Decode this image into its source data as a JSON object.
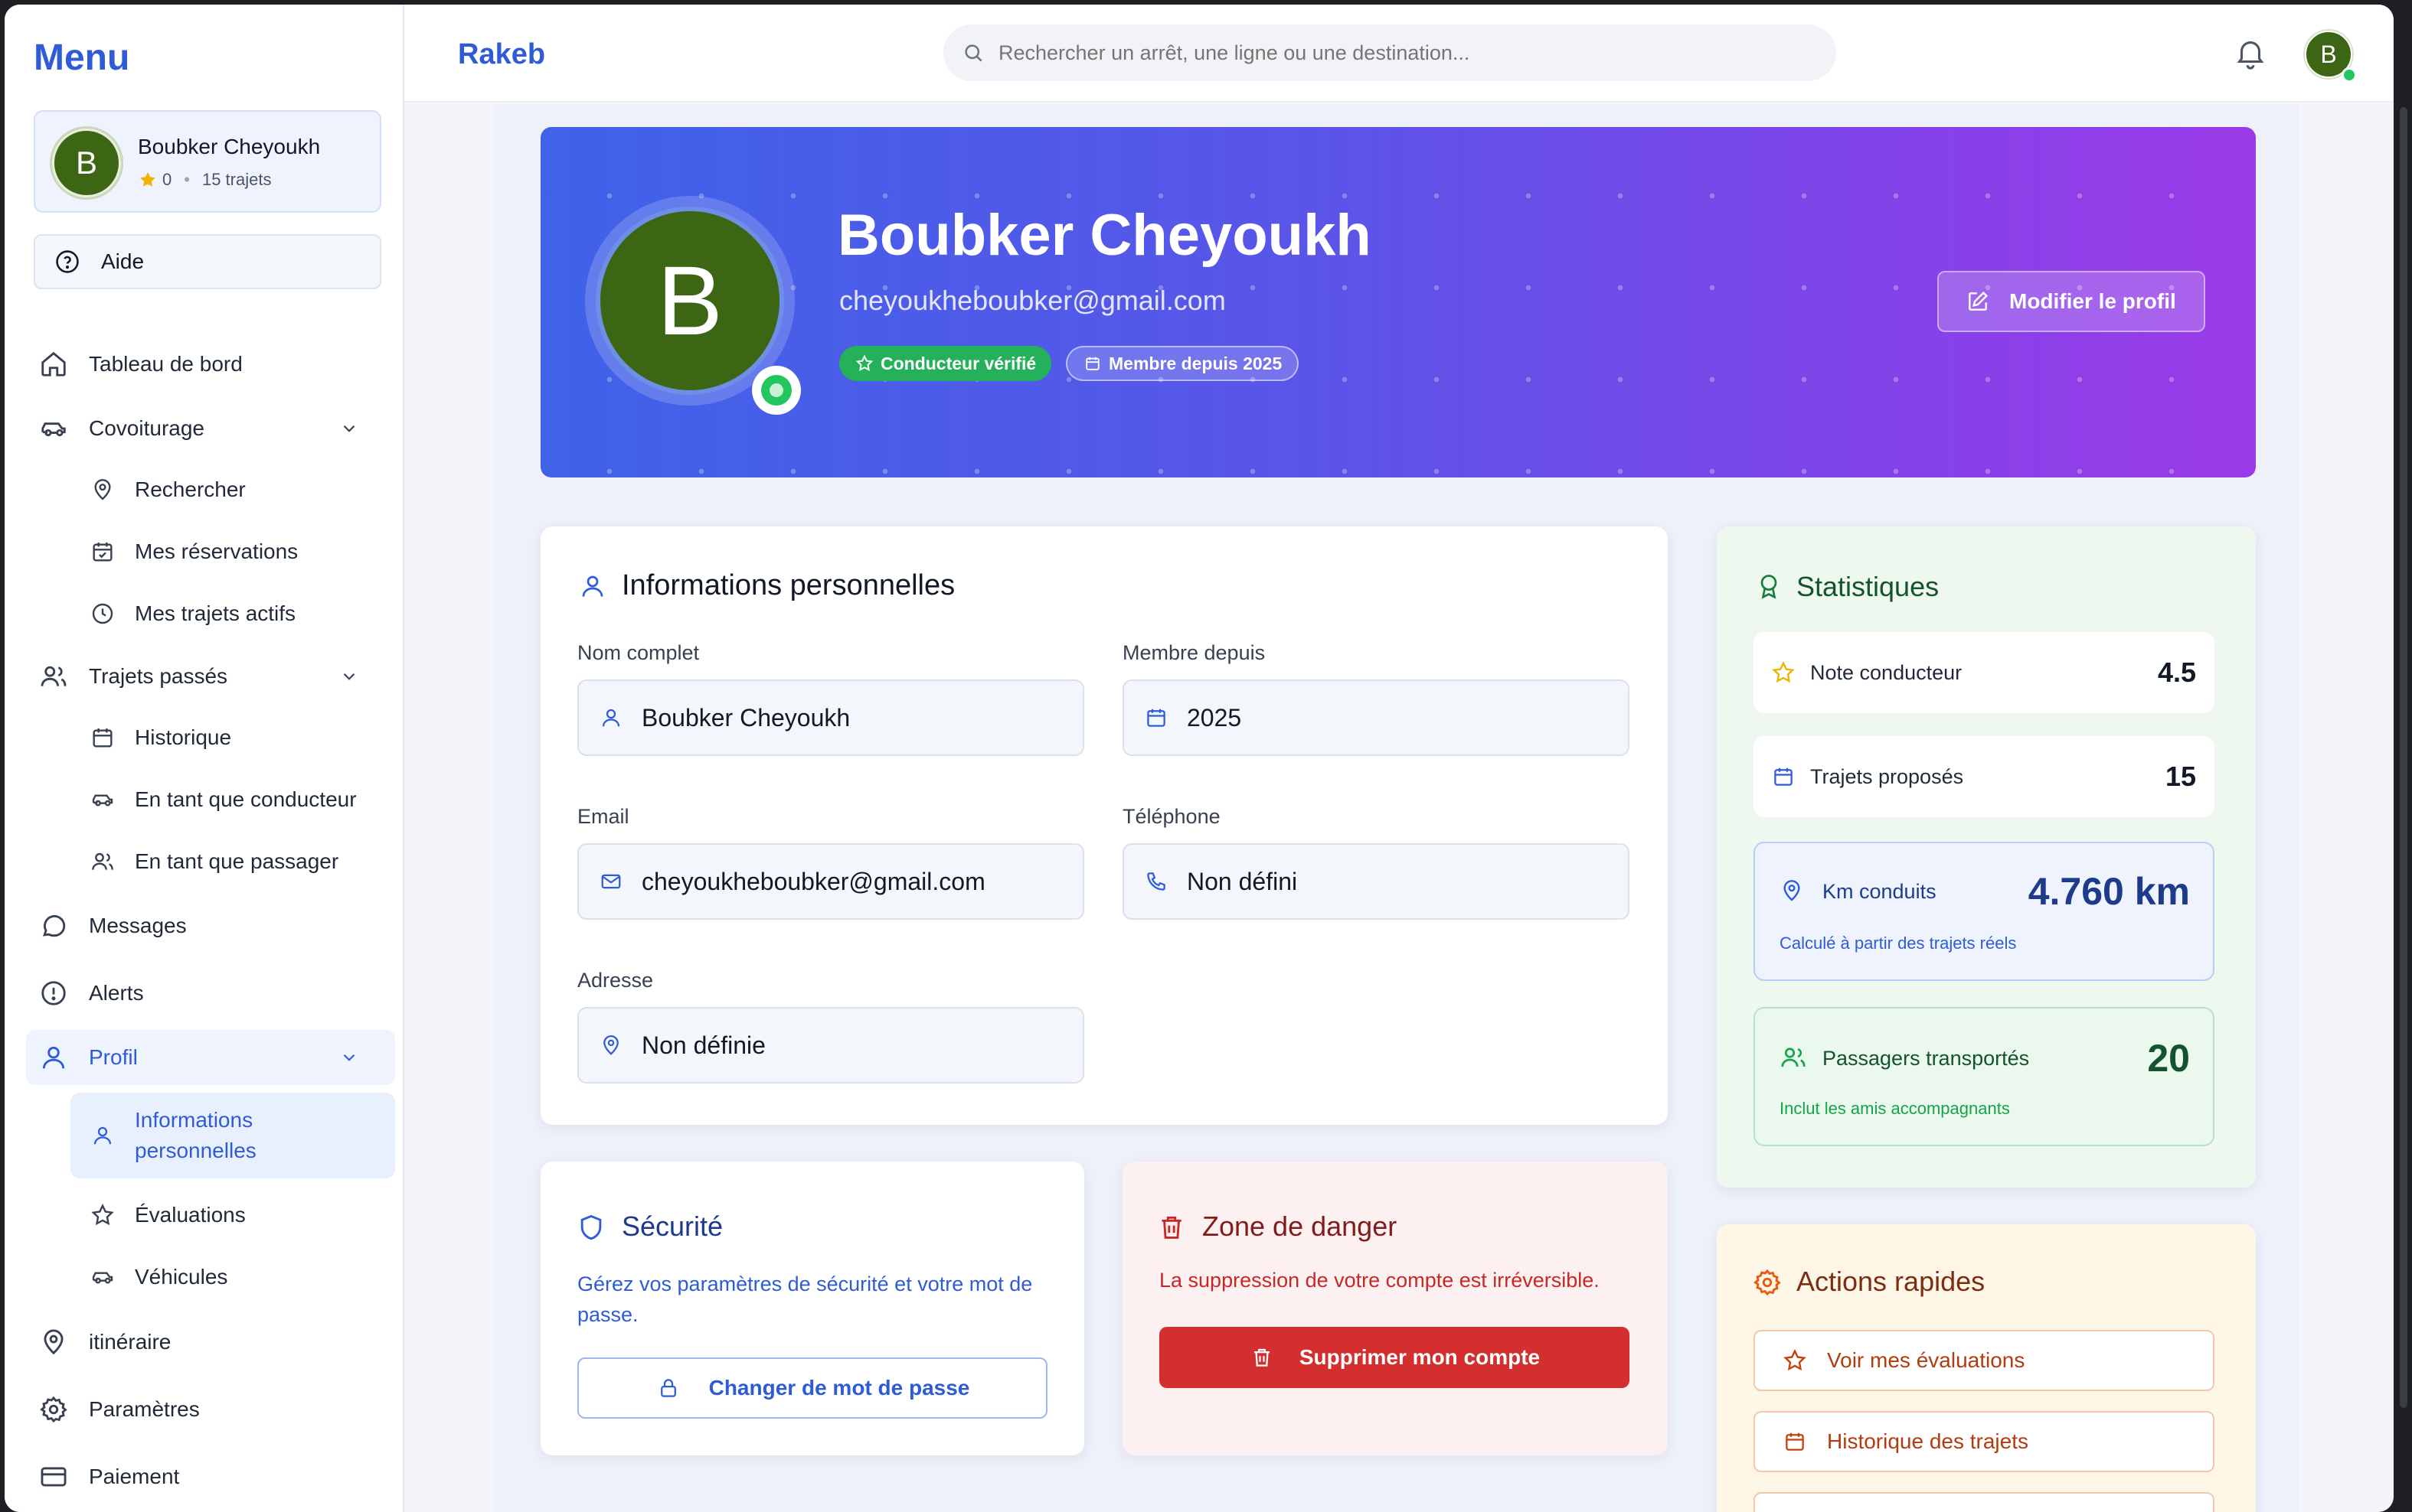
{
  "sidebar": {
    "title": "Menu",
    "user": {
      "initial": "B",
      "name": "Boubker Cheyoukh",
      "rating": "0",
      "separator": "•",
      "trips": "15 trajets"
    },
    "help_label": "Aide",
    "items": [
      {
        "label": "Tableau de bord",
        "icon": "home-icon"
      },
      {
        "label": "Covoiturage",
        "icon": "car-icon"
      },
      {
        "label": "Rechercher",
        "icon": "map-pin-icon"
      },
      {
        "label": "Mes réservations",
        "icon": "calendar-check-icon"
      },
      {
        "label": "Mes trajets actifs",
        "icon": "clock-icon"
      },
      {
        "label": "Trajets passés",
        "icon": "users-icon"
      },
      {
        "label": "Historique",
        "icon": "calendar-icon"
      },
      {
        "label": "En tant que conducteur",
        "icon": "car-icon"
      },
      {
        "label": "En tant que passager",
        "icon": "users-icon"
      },
      {
        "label": "Messages",
        "icon": "message-icon"
      },
      {
        "label": "Alerts",
        "icon": "alert-icon"
      },
      {
        "label": "Profil",
        "icon": "user-icon"
      },
      {
        "label": "Informations personnelles",
        "icon": "user-icon"
      },
      {
        "label": "Évaluations",
        "icon": "star-icon"
      },
      {
        "label": "Véhicules",
        "icon": "car-icon"
      },
      {
        "label": "itinéraire",
        "icon": "map-pin-icon"
      },
      {
        "label": "Paramètres",
        "icon": "gear-icon"
      },
      {
        "label": "Paiement",
        "icon": "credit-card-icon"
      }
    ]
  },
  "topbar": {
    "brand": "Rakeb",
    "search_placeholder": "Rechercher un arrêt, une ligne ou une destination...",
    "avatar_initial": "B"
  },
  "hero": {
    "initial": "B",
    "name": "Boubker Cheyoukh",
    "email": "cheyoukheboubker@gmail.com",
    "badge_verified": "Conducteur vérifié",
    "badge_member": "Membre depuis 2025",
    "edit_button": "Modifier le profil"
  },
  "personal_info": {
    "title": "Informations personnelles",
    "full_name_label": "Nom complet",
    "full_name": "Boubker Cheyoukh",
    "member_since_label": "Membre depuis",
    "member_since": "2025",
    "email_label": "Email",
    "email": "cheyoukheboubker@gmail.com",
    "phone_label": "Téléphone",
    "phone": "Non défini",
    "address_label": "Adresse",
    "address": "Non définie"
  },
  "security": {
    "title": "Sécurité",
    "description": "Gérez vos paramètres de sécurité et votre mot de passe.",
    "button": "Changer de mot de passe"
  },
  "danger": {
    "title": "Zone de danger",
    "description": "La suppression de votre compte est irréversible.",
    "button": "Supprimer mon compte"
  },
  "stats": {
    "title": "Statistiques",
    "rating_label": "Note conducteur",
    "rating_value": "4.5",
    "trips_label": "Trajets proposés",
    "trips_value": "15",
    "km_label": "Km conduits",
    "km_value": "4.760 km",
    "km_note": "Calculé à partir des trajets réels",
    "passengers_label": "Passagers transportés",
    "passengers_value": "20",
    "passengers_note": "Inclut les amis accompagnants"
  },
  "quick_actions": {
    "title": "Actions rapides",
    "items": [
      "Voir mes évaluations",
      "Historique des trajets"
    ]
  },
  "colors": {
    "brand": "#2f5bd7",
    "avatar": "#3d6614",
    "online": "#22c55e",
    "danger": "#d32f2f",
    "hero_start": "#3f63e8",
    "hero_end": "#9a3be8"
  }
}
